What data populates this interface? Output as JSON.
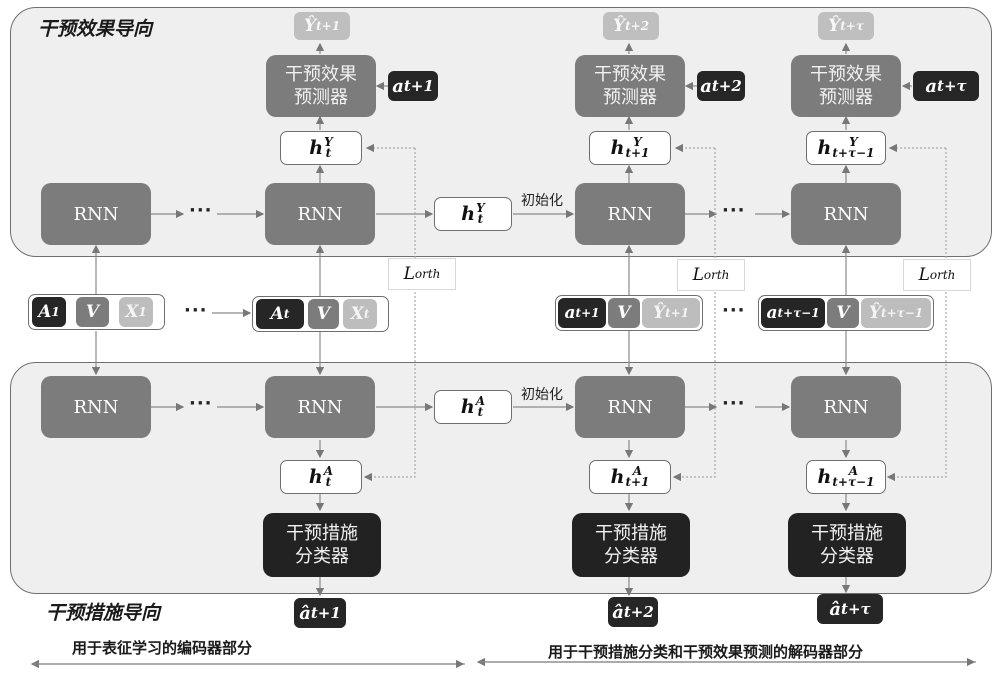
{
  "panels": {
    "top": {
      "title": "干预效果导向"
    },
    "bottom": {
      "title": "干预措施导向"
    }
  },
  "rnn_label": "RNN",
  "init_label": "初始化",
  "ellipsis": "···",
  "predictor_label": [
    "干预效果",
    "预测器"
  ],
  "classifier_label": [
    "干预措施",
    "分类器"
  ],
  "loss_label": {
    "base": "L",
    "sub": "orth"
  },
  "outcome_outputs": [
    {
      "base": "Ŷ",
      "sub": "t+1"
    },
    {
      "base": "Ŷ",
      "sub": "t+2"
    },
    {
      "base": "Ŷ",
      "sub": "t+τ"
    }
  ],
  "predictor_action_inputs": [
    {
      "base": "a",
      "sub": "t+1"
    },
    {
      "base": "a",
      "sub": "t+2"
    },
    {
      "base": "a",
      "sub": "t+τ"
    }
  ],
  "outcome_hidden": [
    {
      "base": "h",
      "sup": "Y",
      "sub": "t"
    },
    {
      "base": "h",
      "sup": "Y",
      "sub": "t+1"
    },
    {
      "base": "h",
      "sup": "Y",
      "sub": "t+τ−1"
    }
  ],
  "treatment_hidden": [
    {
      "base": "h",
      "sup": "A",
      "sub": "t"
    },
    {
      "base": "h",
      "sup": "A",
      "sub": "t+1"
    },
    {
      "base": "h",
      "sup": "A",
      "sub": "t+τ−1"
    }
  ],
  "init_hidden": {
    "outcome": {
      "base": "h",
      "sup": "Y",
      "sub": "t"
    },
    "treatment": {
      "base": "h",
      "sup": "A",
      "sub": "t"
    }
  },
  "classifier_outputs": [
    {
      "base": "â",
      "sub": "t+1"
    },
    {
      "base": "â",
      "sub": "t+2"
    },
    {
      "base": "â",
      "sub": "t+τ"
    }
  ],
  "input_groups": [
    {
      "chips": [
        {
          "base": "A",
          "sub": "1",
          "tone": "dark"
        },
        {
          "base": "V",
          "sub": "",
          "tone": "mid"
        },
        {
          "base": "X",
          "sub": "1",
          "tone": "light"
        }
      ]
    },
    {
      "chips": [
        {
          "base": "A",
          "sub": "t",
          "tone": "dark"
        },
        {
          "base": "V",
          "sub": "",
          "tone": "mid"
        },
        {
          "base": "X",
          "sub": "t",
          "tone": "light"
        }
      ]
    },
    {
      "chips": [
        {
          "base": "a",
          "sub": "t+1",
          "tone": "dark"
        },
        {
          "base": "V",
          "sub": "",
          "tone": "mid"
        },
        {
          "base": "Ŷ",
          "sub": "t+1",
          "tone": "light"
        }
      ]
    },
    {
      "chips": [
        {
          "base": "a",
          "sub": "t+τ−1",
          "tone": "dark"
        },
        {
          "base": "V",
          "sub": "",
          "tone": "mid"
        },
        {
          "base": "Ŷ",
          "sub": "t+τ−1",
          "tone": "light"
        }
      ]
    }
  ],
  "footer": {
    "encoder": "用于表征学习的编码器部分",
    "decoder": "用于干预措施分类和干预效果预测的解码器部分"
  }
}
